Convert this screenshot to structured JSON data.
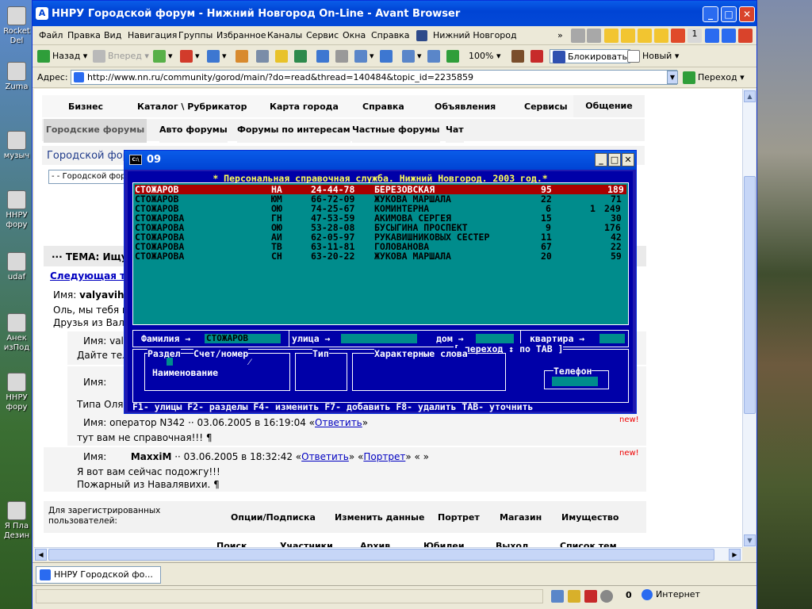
{
  "desktop": {
    "icons": [
      {
        "label": "Rocket Del"
      },
      {
        "label": "Zuma"
      },
      {
        "label": "музыч"
      },
      {
        "label": "ННРУ фору"
      },
      {
        "label": "udaf"
      },
      {
        "label": "Анек изПод"
      },
      {
        "label": "ННРУ фору"
      },
      {
        "label": "Я Пла Дезин"
      }
    ]
  },
  "window": {
    "title": "ННРУ Городской форум - Нижний Новгород On-Line - Avant Browser"
  },
  "menu": {
    "items": [
      "Файл",
      "Правка",
      "Вид",
      "Навигация",
      "Группы",
      "Избранное",
      "Каналы",
      "Сервис",
      "Окна",
      "Справка"
    ],
    "right_label": "Нижний Новгород"
  },
  "toolbar": {
    "back": "Назад",
    "forward": "Вперед",
    "zoom": "100%",
    "block": "Блокировать",
    "new": "Новый"
  },
  "address": {
    "label": "Адрес:",
    "url": "http://www.nn.ru/community/gorod/main/?do=read&thread=140484&topic_id=2235859",
    "go": "Переход"
  },
  "site": {
    "nav1": [
      "Бизнес",
      "Каталог \\ Рубрикатор",
      "Карта города",
      "Справка",
      "Объявления",
      "Сервисы",
      "Общение"
    ],
    "nav2": [
      "Городские форумы",
      "Авто форумы",
      "Форумы по интересам",
      "Частные форумы",
      "Чат"
    ],
    "forum_title": "Городской фор",
    "select_value": "- - Городской фор",
    "topic_label": "··· ТЕМА: Ищу",
    "next_topic": "Следующая тем",
    "post1_name_label": "Имя:",
    "post1_name": "valyaviha",
    "post1_line1": "Оль, мы тебя и",
    "post1_line2": "Друзья из Валя",
    "post2_name": "Имя: valy",
    "post2_line": "Дайте тел",
    "post3_name": "Имя:",
    "post3_line": "Типа Оля ,",
    "post4_header": "Имя: оператор N342 ·· 03.06.2005 в 16:19:04 «",
    "post4_reply": "Ответить",
    "post4_close": "»",
    "post4_text": "тут вам не справочная!!! ¶",
    "post4_new": "new!",
    "post5_name_label": "Имя:",
    "post5_name": "MaxxiM",
    "post5_date": "·· 03.06.2005 в 18:32:42 «",
    "post5_reply": "Ответить",
    "post5_mid": "» «",
    "post5_portrait": "Портрет",
    "post5_end": "» «      »",
    "post5_line1": "Я вот вам сейчас подожгу!!!",
    "post5_line2": "Пожарный из Навалявихи. ¶",
    "post5_new": "new!",
    "registered": "Для зарегистрированных пользователей:",
    "bottom_links": [
      "Опции/Подписка",
      "Изменить данные",
      "Портрет",
      "Магазин",
      "Имущество"
    ],
    "bottom_links2": [
      "Поиск",
      "Участники",
      "Архив",
      "Юбилеи",
      "Выход",
      "Список тем"
    ]
  },
  "console": {
    "title": "09",
    "header": "* Персональная справочная служба. Нижний Новгород. 2003 год.*",
    "rows": [
      {
        "name": "СТОЖАРОВ",
        "init": "НА",
        "phone": "24-44-78",
        "street": "БЕРЕЗОВСКАЯ",
        "house": "95",
        "corp": "",
        "flat": "189"
      },
      {
        "name": "СТОЖАРОВ",
        "init": "ЮМ",
        "phone": "66-72-09",
        "street": "ЖУКОВА МАРШАЛА",
        "house": "22",
        "corp": "",
        "flat": "71"
      },
      {
        "name": "СТОЖАРОВ",
        "init": "ОЮ",
        "phone": "74-25-67",
        "street": "КОМИНТЕРНА",
        "house": "6",
        "corp": "1",
        "flat": "249"
      },
      {
        "name": "СТОЖАРОВА",
        "init": "ГН",
        "phone": "47-53-59",
        "street": "АКИМОВА СЕРГЕЯ",
        "house": "15",
        "corp": "",
        "flat": "30"
      },
      {
        "name": "СТОЖАРОВА",
        "init": "ОЮ",
        "phone": "53-28-08",
        "street": "БУСЫГИНА ПРОСПЕКТ",
        "house": "9",
        "corp": "",
        "flat": "176"
      },
      {
        "name": "СТОЖАРОВА",
        "init": "АИ",
        "phone": "62-05-97",
        "street": "РУКАВИШНИКОВЫХ СЕСТЕР",
        "house": "11",
        "corp": "",
        "flat": "42"
      },
      {
        "name": "СТОЖАРОВА",
        "init": "ТВ",
        "phone": "63-11-81",
        "street": "ГОЛОВАНОВА",
        "house": "67",
        "corp": "",
        "flat": "22"
      },
      {
        "name": "СТОЖАРОВА",
        "init": "СН",
        "phone": "63-20-22",
        "street": "ЖУКОВА МАРШАЛА",
        "house": "20",
        "corp": "",
        "flat": "59"
      }
    ],
    "form": {
      "surname_label": "Фамилия →",
      "surname_value": "СТОЖАРОВ",
      "street_label": "улица →",
      "house_label": "дом →",
      "flat_label": "квартира →",
      "hint": "[ переход ↕ по TAB ]"
    },
    "cat": {
      "section": "Раздел",
      "account": "Счет/номер",
      "type": "Тип",
      "keywords": "Характерные слова",
      "name": "Наименование",
      "phone": "Телефон"
    },
    "fkeys": "F1- улицы F2- разделы F4- изменить F7- добавить F8- удалить TAB- уточнить"
  },
  "tabbar": {
    "tab": "ННРУ Городской фо..."
  },
  "status": {
    "count": "0",
    "zone": "Интернет"
  }
}
